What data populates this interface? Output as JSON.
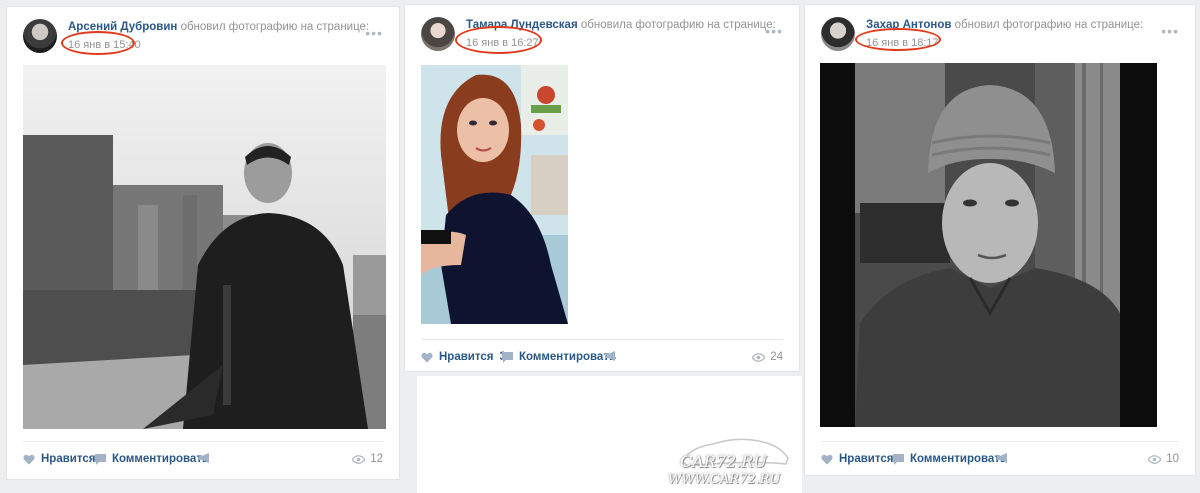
{
  "posts": [
    {
      "author": "Арсений Дубровин",
      "action": "обновил фотографию на странице:",
      "date": "16 янв в 15:40",
      "like_label": "Нравится",
      "like_count": "",
      "comment_label": "Комментировать",
      "views": "12"
    },
    {
      "author": "Тамара Лундевская",
      "action": "обновила фотографию на странице:",
      "date": "16 янв в 16:27",
      "like_label": "Нравится",
      "like_count": "3",
      "comment_label": "Комментировать",
      "views": "24"
    },
    {
      "author": "Захар Антонов",
      "action": "обновил фотографию на странице:",
      "date": "16 янв в 18:17",
      "like_label": "Нравится",
      "like_count": "",
      "comment_label": "Комментировать",
      "views": "10"
    }
  ],
  "menu_icon": "dots-icon",
  "watermark": {
    "line1": "CAR72.RU",
    "line2": "WWW.CAR72.RU"
  },
  "colors": {
    "link": "#2a5885",
    "muted": "#939393",
    "highlight": "#e03a1a"
  }
}
